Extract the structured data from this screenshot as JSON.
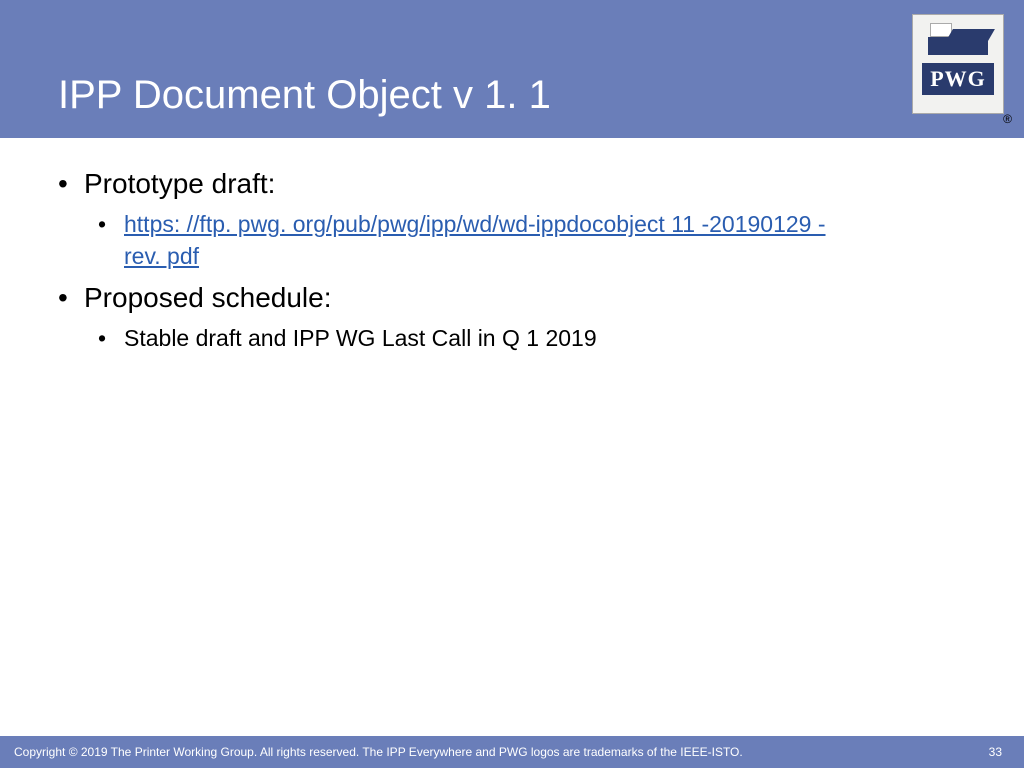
{
  "header": {
    "title": "IPP Document Object v 1. 1",
    "logo_text": "PWG",
    "registered": "®"
  },
  "bullets": {
    "b1": "Prototype draft:",
    "b1_sub_link_line1": "https: //ftp. pwg. org/pub/pwg/ipp/wd/wd-ippdocobject 11 -20190129 -",
    "b1_sub_link_line2": "rev. pdf",
    "b2": "Proposed schedule:",
    "b2_sub": "Stable draft and IPP WG Last Call in Q 1 2019"
  },
  "footer": {
    "copyright": "Copyright © 2019 The Printer Working Group. All rights reserved. The IPP Everywhere and PWG logos are trademarks of the IEEE-ISTO.",
    "page": "33"
  }
}
